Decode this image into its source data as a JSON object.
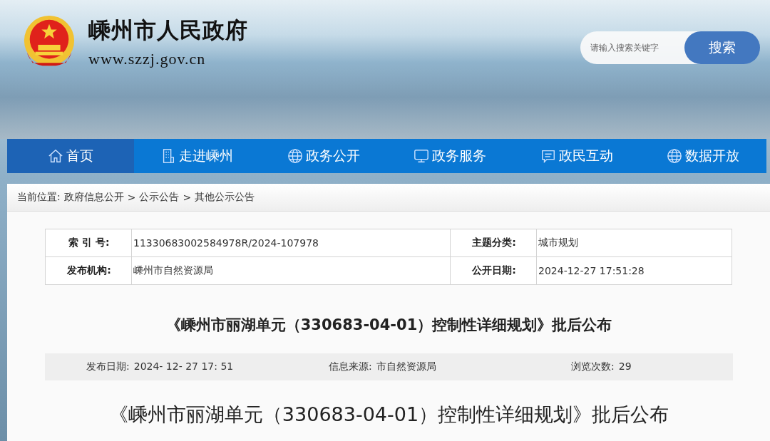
{
  "header": {
    "site_name": "嵊州市人民政府",
    "site_url": "www.szzj.gov.cn",
    "search": {
      "placeholder": "请输入搜索关键字",
      "button": "搜索"
    }
  },
  "nav": [
    {
      "label": "首页",
      "kind": "home",
      "selected": true
    },
    {
      "label": "走进嵊州",
      "kind": "building",
      "selected": false
    },
    {
      "label": "政务公开",
      "kind": "globe",
      "selected": false
    },
    {
      "label": "政务服务",
      "kind": "monitor",
      "selected": false
    },
    {
      "label": "政民互动",
      "kind": "chat",
      "selected": false
    },
    {
      "label": "数据开放",
      "kind": "globe",
      "selected": false
    }
  ],
  "breadcrumb": {
    "prefix": "当前位置:",
    "items": [
      "政府信息公开",
      "公示公告",
      "其他公示公告"
    ],
    "separator": ">"
  },
  "info_table": [
    [
      {
        "label": "索 引 号:",
        "value": "11330683002584978R/2024-107978"
      },
      {
        "label": "主题分类:",
        "value": "城市规划"
      }
    ],
    [
      {
        "label": "发布机构:",
        "value": "嵊州市自然资源局"
      },
      {
        "label": "公开日期:",
        "value": "2024-12-27 17:51:28"
      }
    ]
  ],
  "article": {
    "title": "《嵊州市丽湖单元（330683-04-01）控制性详细规划》批后公布",
    "meta": [
      {
        "label": "发布日期:",
        "value": "2024- 12- 27 17: 51"
      },
      {
        "label": "信息来源:",
        "value": "市自然资源局"
      },
      {
        "label": "浏览次数:",
        "value": "29"
      }
    ],
    "heading": "《嵊州市丽湖单元（330683-04-01）控制性详细规划》批后公布"
  }
}
